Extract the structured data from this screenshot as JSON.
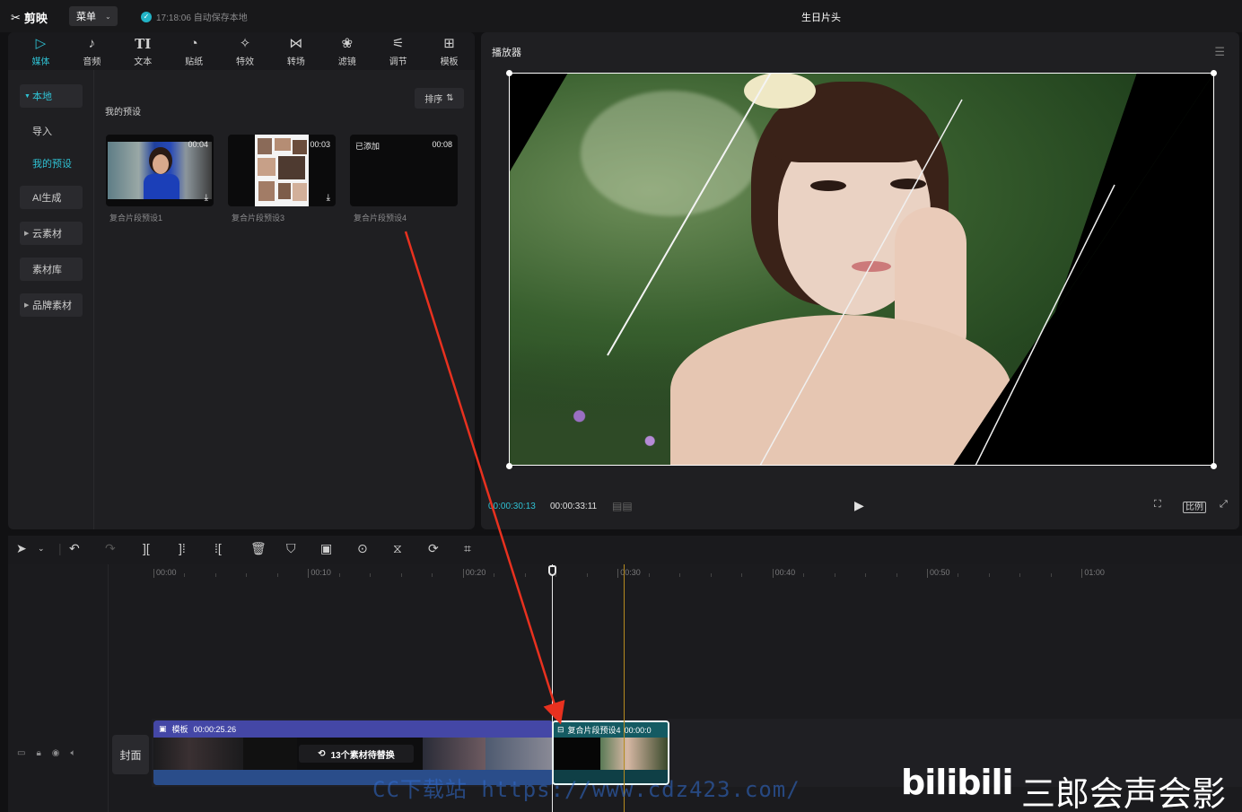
{
  "app": {
    "logo_text": "剪映",
    "menu_label": "菜单",
    "save_status": "17:18:06 自动保存本地",
    "project_title": "生日片头"
  },
  "toolbar": [
    {
      "label": "媒体",
      "icon": "media-icon",
      "glyph": "▷"
    },
    {
      "label": "音频",
      "icon": "audio-icon",
      "glyph": "♪"
    },
    {
      "label": "文本",
      "icon": "text-icon",
      "glyph": "TI"
    },
    {
      "label": "贴纸",
      "icon": "sticker-icon",
      "glyph": "◔"
    },
    {
      "label": "特效",
      "icon": "effects-icon",
      "glyph": "✧"
    },
    {
      "label": "转场",
      "icon": "transition-icon",
      "glyph": "⋈"
    },
    {
      "label": "滤镜",
      "icon": "filter-icon",
      "glyph": "❀"
    },
    {
      "label": "调节",
      "icon": "adjust-icon",
      "glyph": "⚟"
    },
    {
      "label": "模板",
      "icon": "template-icon",
      "glyph": "⊞"
    }
  ],
  "sidenav": {
    "local": "本地",
    "import": "导入",
    "my_presets": "我的预设",
    "ai_generate": "AI生成",
    "cloud": "云素材",
    "library": "素材库",
    "brand": "品牌素材"
  },
  "media": {
    "section_title": "我的预设",
    "sort_label": "排序",
    "cards": [
      {
        "duration": "00:04",
        "label": "复合片段预设1"
      },
      {
        "duration": "00:03",
        "label": "复合片段预设3"
      },
      {
        "duration": "00:08",
        "label": "复合片段预设4",
        "added": "已添加"
      }
    ]
  },
  "player": {
    "title": "播放器",
    "current_time": "00:00:30:13",
    "total_time": "00:00:33:11",
    "ratio_label": "比例"
  },
  "timeline": {
    "ruler_labels": [
      "00:00",
      "00:10",
      "00:20",
      "00:30",
      "00:40",
      "00:50",
      "01:00"
    ],
    "cover_label": "封面",
    "clip1": {
      "badge": "模板",
      "duration": "00:00:25.26",
      "replace_text": "13个素材待替换"
    },
    "clip2": {
      "name": "复合片段预设4",
      "duration": "00:00:0"
    }
  },
  "watermark": {
    "url": "CC下载站 https://www.cdz423.com/",
    "bili_logo": "bilibili",
    "channel": "三郎会声会影"
  },
  "colors": {
    "accent": "#2fc1d3",
    "template_clip": "#4447a6",
    "compound_clip": "#145a62",
    "arrow": "#e8311f"
  }
}
